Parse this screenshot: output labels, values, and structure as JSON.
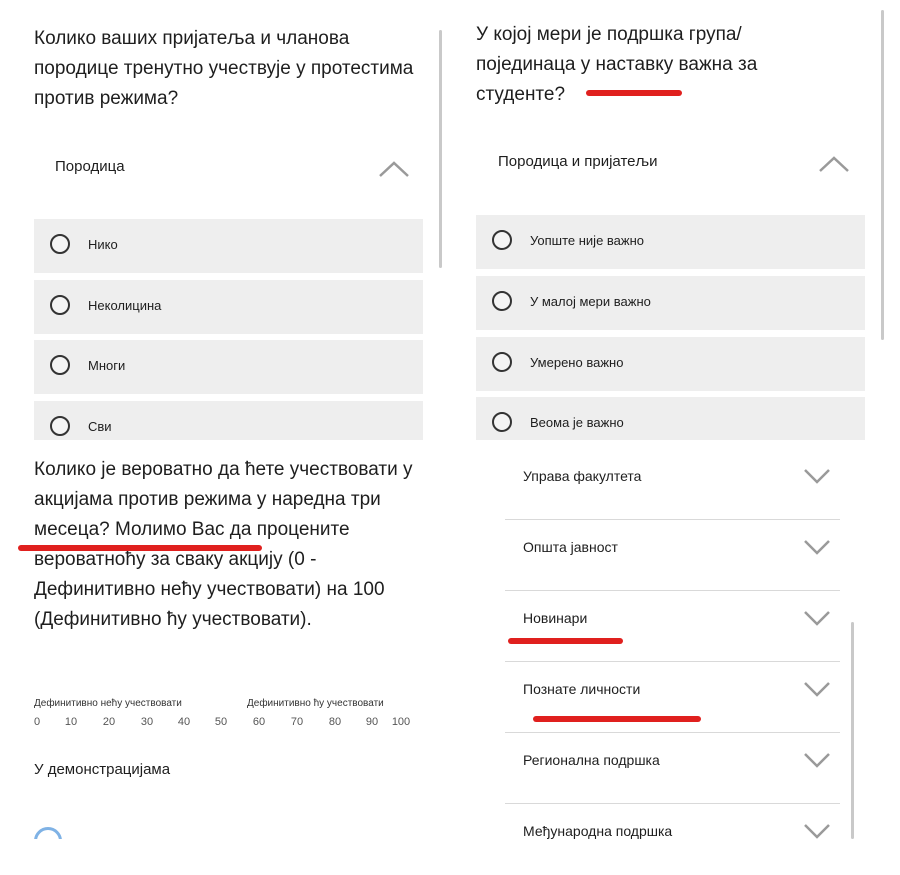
{
  "panel_tl": {
    "question": "Колико ваших пријатеља и чланова породице тренутно учествује у протестима против режима?",
    "section": "Породица",
    "options": [
      "Нико",
      "Неколицина",
      "Многи",
      "Сви"
    ]
  },
  "panel_tr": {
    "question": "У којој мери је подршка група/ појединаца у наставку важна за студенте?",
    "section": "Породица и пријатељи",
    "options": [
      "Уопште није важно",
      "У малој мери важно",
      "Умерено важно",
      "Веома је важно"
    ]
  },
  "panel_bl": {
    "question": "Колико је вероватно да ћете учествовати у акцијама против режима у наредна три месеца? Молимо Вас да процените вероватноћу за сваку акцију (0 - Дефинитивно нећу учествовати) на 100 (Дефинитивно ћу учествовати).",
    "scale_left": "Дефинитивно нећу учествовати",
    "scale_right": "Дефинитивно ћу учествовати",
    "ticks": [
      "0",
      "10",
      "20",
      "30",
      "40",
      "50",
      "60",
      "70",
      "80",
      "90",
      "100"
    ],
    "item_label": "У демонстрацијама"
  },
  "panel_br": {
    "groups": [
      "Управа факултета",
      "Општа јавност",
      "Новинари",
      "Познате личности",
      "Регионална подршка",
      "Међународна подршка"
    ]
  },
  "colors": {
    "annotation": "#e0201e",
    "option_bg": "#eeeeee",
    "text": "#1e1e1e"
  },
  "icons": {
    "expand": "chevron-up-icon",
    "collapse": "chevron-down-icon",
    "radio": "radio-circle-icon"
  }
}
